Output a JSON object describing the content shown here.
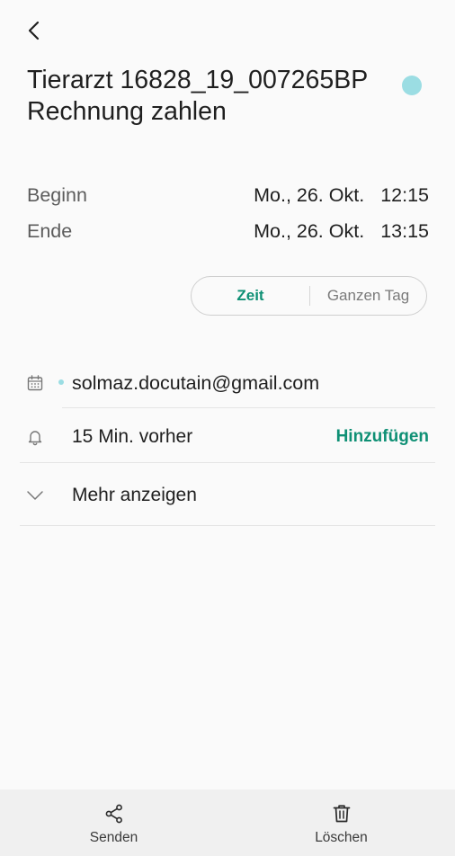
{
  "header": {
    "back_icon": "chevron-left-icon"
  },
  "event": {
    "title": "Tierarzt 16828_19_007265BP Rechnung zahlen",
    "color": "#9bdde3"
  },
  "times": {
    "start": {
      "label": "Beginn",
      "date": "Mo., 26. Okt.",
      "time": "12:15"
    },
    "end": {
      "label": "Ende",
      "date": "Mo., 26. Okt.",
      "time": "13:15"
    }
  },
  "duration_toggle": {
    "options": [
      "Zeit",
      "Ganzen Tag"
    ],
    "selected": "Zeit",
    "accent_color": "#0f9075"
  },
  "details": {
    "calendar": {
      "icon": "calendar-icon",
      "account": "solmaz.docutain@gmail.com"
    },
    "reminder": {
      "icon": "bell-icon",
      "value": "15 Min. vorher",
      "add_label": "Hinzufügen"
    },
    "more": {
      "icon": "chevron-down-icon",
      "label": "Mehr anzeigen"
    }
  },
  "bottom_bar": {
    "send": {
      "icon": "share-icon",
      "label": "Senden"
    },
    "delete": {
      "icon": "trash-icon",
      "label": "Löschen"
    }
  }
}
